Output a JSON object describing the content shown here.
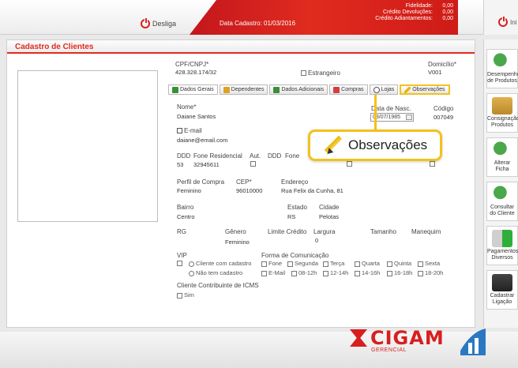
{
  "header": {
    "logout_label": "Desliga",
    "date_label": "Data Cadastro: 01/03/2016",
    "info": [
      {
        "label": "Fidelidade:",
        "value": "0,00"
      },
      {
        "label": "Crédito Devoluções:",
        "value": "0,00"
      },
      {
        "label": "Crédito Adiantamentos:",
        "value": "0,00"
      }
    ],
    "right_label": "Ini"
  },
  "panel": {
    "title": "Cadastro de Clientes"
  },
  "form": {
    "cpf_label": "CPF/CNPJ*",
    "cpf_value": "428.328.174/32",
    "estrangeiro_label": "Estrangeiro",
    "domicilio_label": "Domicílio*",
    "domicilio_value": "V001",
    "tabs": [
      {
        "label": "Dados Gerais"
      },
      {
        "label": "Dependentes"
      },
      {
        "label": "Dados Adicionais"
      },
      {
        "label": "Compras"
      },
      {
        "label": "Lojas"
      },
      {
        "label": "Observações"
      }
    ],
    "nome_label": "Nome*",
    "nome_value": "Daiane Santos",
    "data_nasc_label": "Data de Nasc.",
    "data_nasc_value": "03/07/1985",
    "codigo_label": "Código",
    "codigo_value": "007049",
    "email_label": "E-mail",
    "email_value": "daiane@email.com",
    "ddd_label": "DDD",
    "fone_res_label": "Fone Residencial",
    "aut_label": "Aut.",
    "ddd2_label": "DDD",
    "fone2_label": "Fone",
    "ddd_value": "53",
    "fone_res_value": "32945611",
    "perfil_label": "Perfil de Compra",
    "perfil_value": "Feminino",
    "cep_label": "CEP*",
    "cep_value": "96010000",
    "endereco_label": "Endereço",
    "endereco_value": "Rua Felix da Cunha, 81",
    "bairro_label": "Bairro",
    "bairro_value": "Centro",
    "estado_label": "Estado",
    "estado_value": "RS",
    "cidade_label": "Cidade",
    "cidade_value": "Pelotas",
    "rg_label": "RG",
    "genero_label": "Gênero",
    "genero_value": "Feminino",
    "limite_label": "Limite Crédito",
    "largura_label": "Largura",
    "largura_value": "0",
    "tamanho_label": "Tamanho",
    "manequim_label": "Manequim",
    "vip_label": "VIP",
    "forma_com_label": "Forma de Comunicação",
    "radio_options": [
      "Cliente com cadastro",
      "Não tem cadastro"
    ],
    "com_row1": [
      "Fone",
      "Segunda",
      "Terça",
      "Quarta",
      "Quinta",
      "Sexta"
    ],
    "com_row2": [
      "E-Mail",
      "08-12h",
      "12-14h",
      "14-16h",
      "16-18h",
      "18-20h"
    ],
    "icms_label": "Cliente Contribuinte de ICMS",
    "icms_option": "Sim"
  },
  "callout": {
    "label": "Observações"
  },
  "sidebar": {
    "items": [
      {
        "label": "Desempenho de Produtos"
      },
      {
        "label": "Consignação Produtos"
      },
      {
        "label": "Alterar Ficha"
      },
      {
        "label": "Consultar do Cliente"
      },
      {
        "label": "Pagamentos Diversos"
      },
      {
        "label": "Cadastrar Ligação"
      }
    ]
  },
  "footer": {
    "brand": "CIGAM",
    "brand_sub": "GERENCIAL"
  },
  "colors": {
    "brand_red": "#d81e1e",
    "highlight_yellow": "#f2c21b"
  }
}
